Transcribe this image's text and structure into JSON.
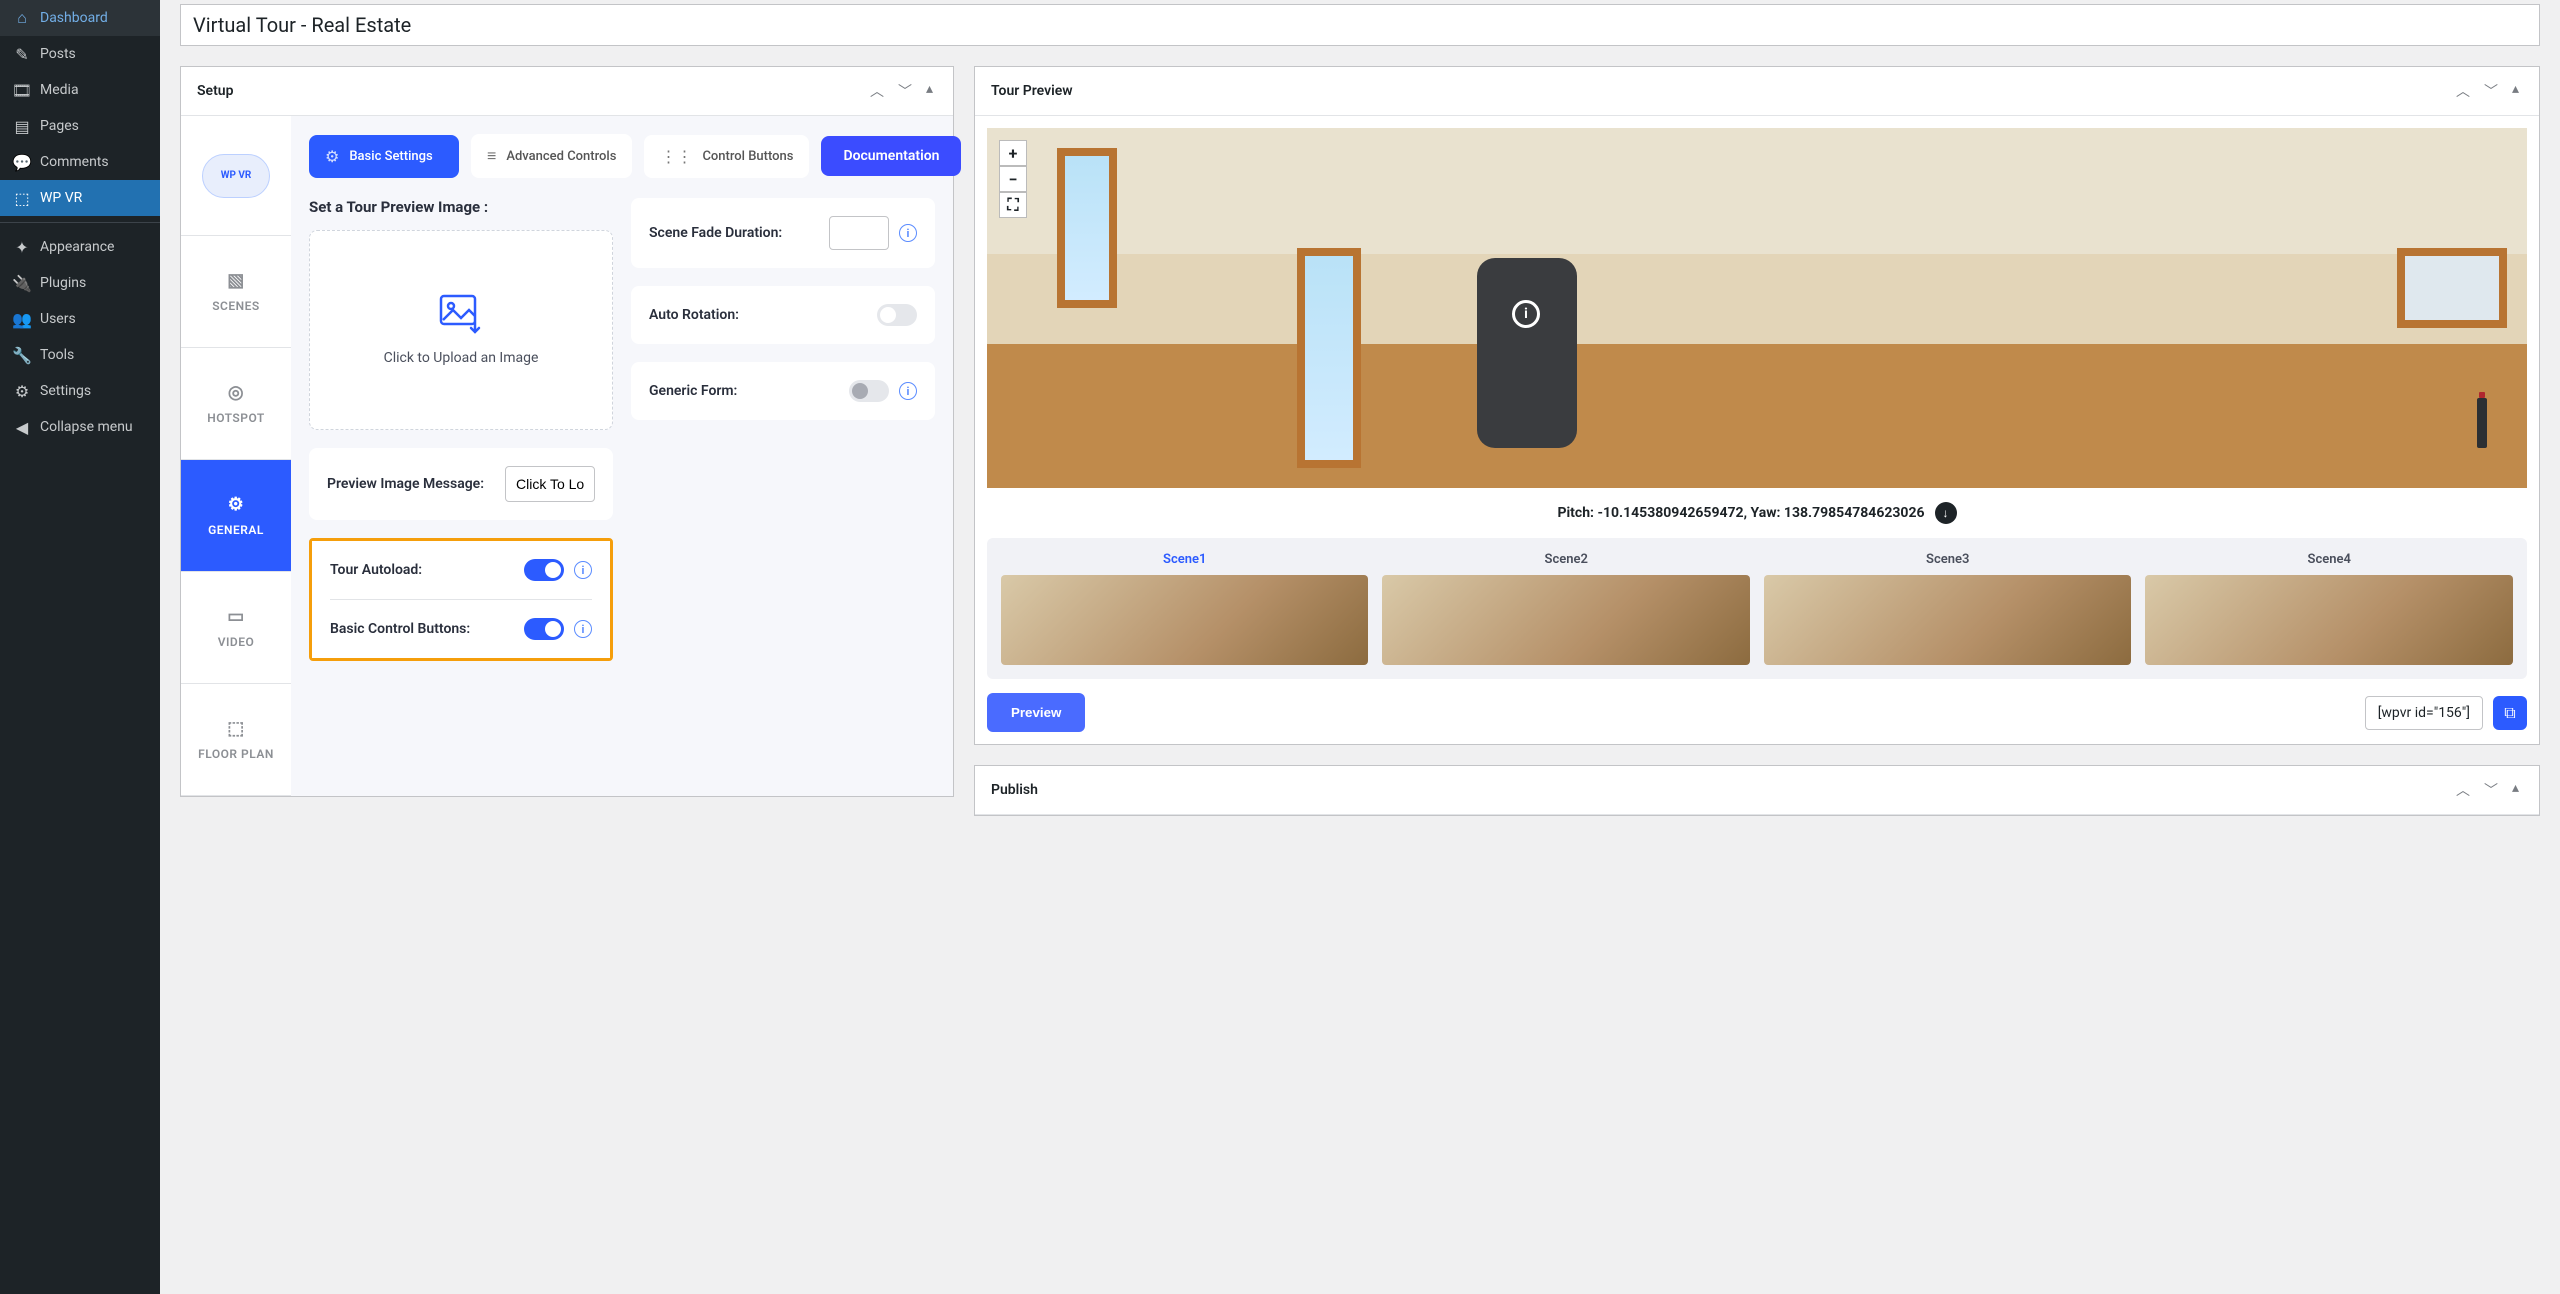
{
  "sidebar": {
    "items": [
      {
        "icon": "⌂",
        "label": "Dashboard"
      },
      {
        "icon": "✎",
        "label": "Posts"
      },
      {
        "icon": "🎞",
        "label": "Media"
      },
      {
        "icon": "▤",
        "label": "Pages"
      },
      {
        "icon": "💬",
        "label": "Comments"
      },
      {
        "icon": "⬚",
        "label": "WP VR"
      }
    ],
    "items2": [
      {
        "icon": "✦",
        "label": "Appearance"
      },
      {
        "icon": "🔌",
        "label": "Plugins"
      },
      {
        "icon": "👥",
        "label": "Users"
      },
      {
        "icon": "🔧",
        "label": "Tools"
      },
      {
        "icon": "⚙",
        "label": "Settings"
      }
    ],
    "collapse": {
      "icon": "◀",
      "label": "Collapse menu"
    }
  },
  "title": "Virtual Tour - Real Estate",
  "setup": {
    "header": "Setup",
    "logo": "WP VR",
    "side_tabs": [
      {
        "icon": "▧",
        "label": "SCENES"
      },
      {
        "icon": "◎",
        "label": "HOTSPOT"
      },
      {
        "icon": "⚙",
        "label": "GENERAL"
      },
      {
        "icon": "▭",
        "label": "VIDEO"
      },
      {
        "icon": "⬚",
        "label": "FLOOR PLAN"
      }
    ],
    "top_tabs": [
      {
        "icon": "⚙",
        "label": "Basic Settings"
      },
      {
        "icon": "≡",
        "label": "Advanced Controls"
      },
      {
        "icon": "⋮⋮",
        "label": "Control Buttons"
      }
    ],
    "doc_btn": "Documentation",
    "preview_img_label": "Set a Tour Preview Image :",
    "upload_text": "Click to Upload an Image",
    "preview_msg_label": "Preview Image Message:",
    "preview_msg_value": "Click To Load",
    "autoload_label": "Tour Autoload:",
    "control_buttons_label": "Basic Control Buttons:",
    "fade_label": "Scene Fade Duration:",
    "fade_value": "",
    "autorotation_label": "Auto Rotation:",
    "generic_form_label": "Generic Form:"
  },
  "preview": {
    "header": "Tour Preview",
    "zoom_in": "+",
    "zoom_out": "−",
    "fullscreen": "⛶",
    "hotspot_char": "i",
    "coords": "Pitch: -10.145380942659472, Yaw: 138.79854784623026",
    "scenes": [
      "Scene1",
      "Scene2",
      "Scene3",
      "Scene4"
    ],
    "preview_btn": "Preview",
    "shortcode": "[wpvr id=\"156\"]"
  },
  "publish": {
    "header": "Publish"
  }
}
